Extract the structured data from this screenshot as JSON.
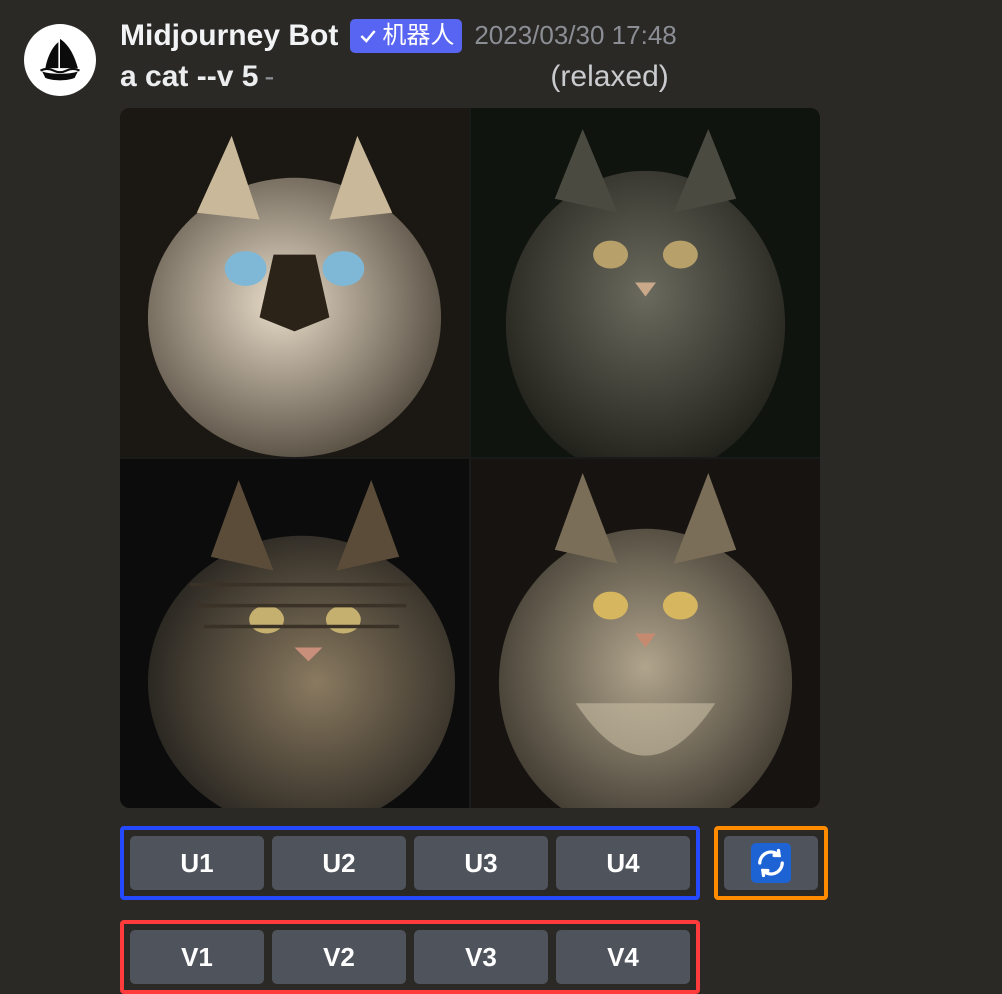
{
  "author": {
    "name": "Midjourney Bot",
    "badge_label": "机器人"
  },
  "timestamp": "2023/03/30 17:48",
  "prompt": {
    "text": "a cat --v 5",
    "separator": "-",
    "mode": "(relaxed)"
  },
  "buttons": {
    "upscale": [
      "U1",
      "U2",
      "U3",
      "U4"
    ],
    "variation": [
      "V1",
      "V2",
      "V3",
      "V4"
    ],
    "reroll_icon": "refresh-icon"
  }
}
